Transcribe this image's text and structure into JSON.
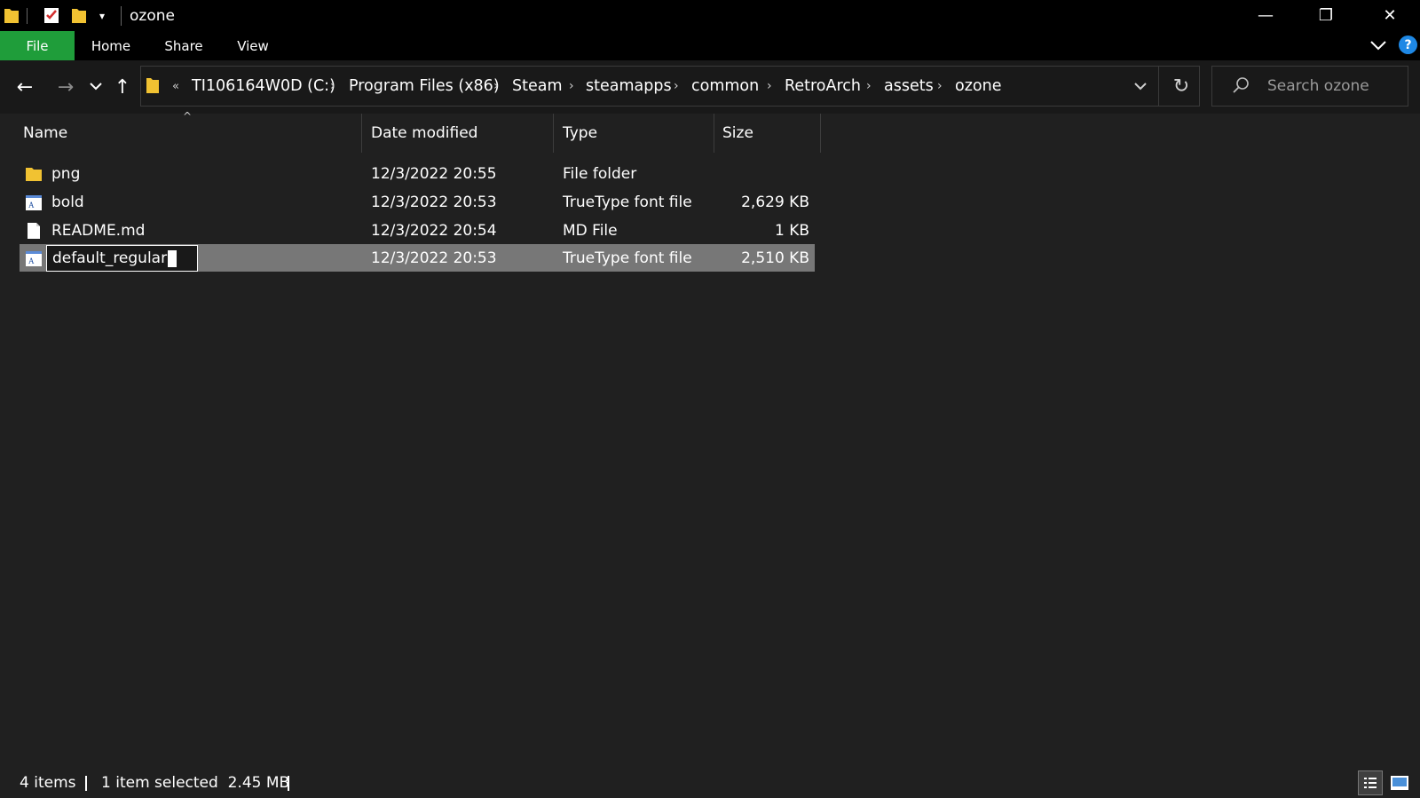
{
  "window": {
    "title": "ozone",
    "minimize": "—",
    "restore": "❐",
    "close": "✕"
  },
  "ribbon": {
    "tabs": [
      "File",
      "Home",
      "Share",
      "View"
    ],
    "file_color": "#1f9d3a",
    "expand_icon": "chevron-down-icon",
    "help": "?"
  },
  "nav": {
    "back": "←",
    "forward": "→",
    "recent": "⌄",
    "up": "↑"
  },
  "address": {
    "overflow": "«",
    "crumbs": [
      "TI106164W0D (C:)",
      "Program Files (x86)",
      "Steam",
      "steamapps",
      "common",
      "RetroArch",
      "assets",
      "ozone"
    ],
    "separator": "›",
    "refresh": "↻"
  },
  "search": {
    "placeholder": "Search ozone"
  },
  "columns": {
    "name": "Name",
    "date": "Date modified",
    "type": "Type",
    "size": "Size",
    "sort_indicator": "^"
  },
  "files": [
    {
      "name": "png",
      "date": "12/3/2022 20:55",
      "type": "File folder",
      "size": "",
      "icon": "folder-icon"
    },
    {
      "name": "bold",
      "date": "12/3/2022 20:53",
      "type": "TrueType font file",
      "size": "2,629 KB",
      "icon": "font-file-icon"
    },
    {
      "name": "README.md",
      "date": "12/3/2022 20:54",
      "type": "MD File",
      "size": "1 KB",
      "icon": "document-icon"
    },
    {
      "name": "default_regular",
      "date": "12/3/2022 20:53",
      "type": "TrueType font file",
      "size": "2,510 KB",
      "icon": "font-file-icon",
      "selected": true,
      "renaming": true
    }
  ],
  "status": {
    "count": "4 items",
    "selection": "1 item selected  2.45 MB"
  },
  "colors": {
    "background": "#202020",
    "titlebar": "#000000",
    "selection": "#777777",
    "folder": "#f1c232",
    "help_blue": "#1e88e5"
  }
}
